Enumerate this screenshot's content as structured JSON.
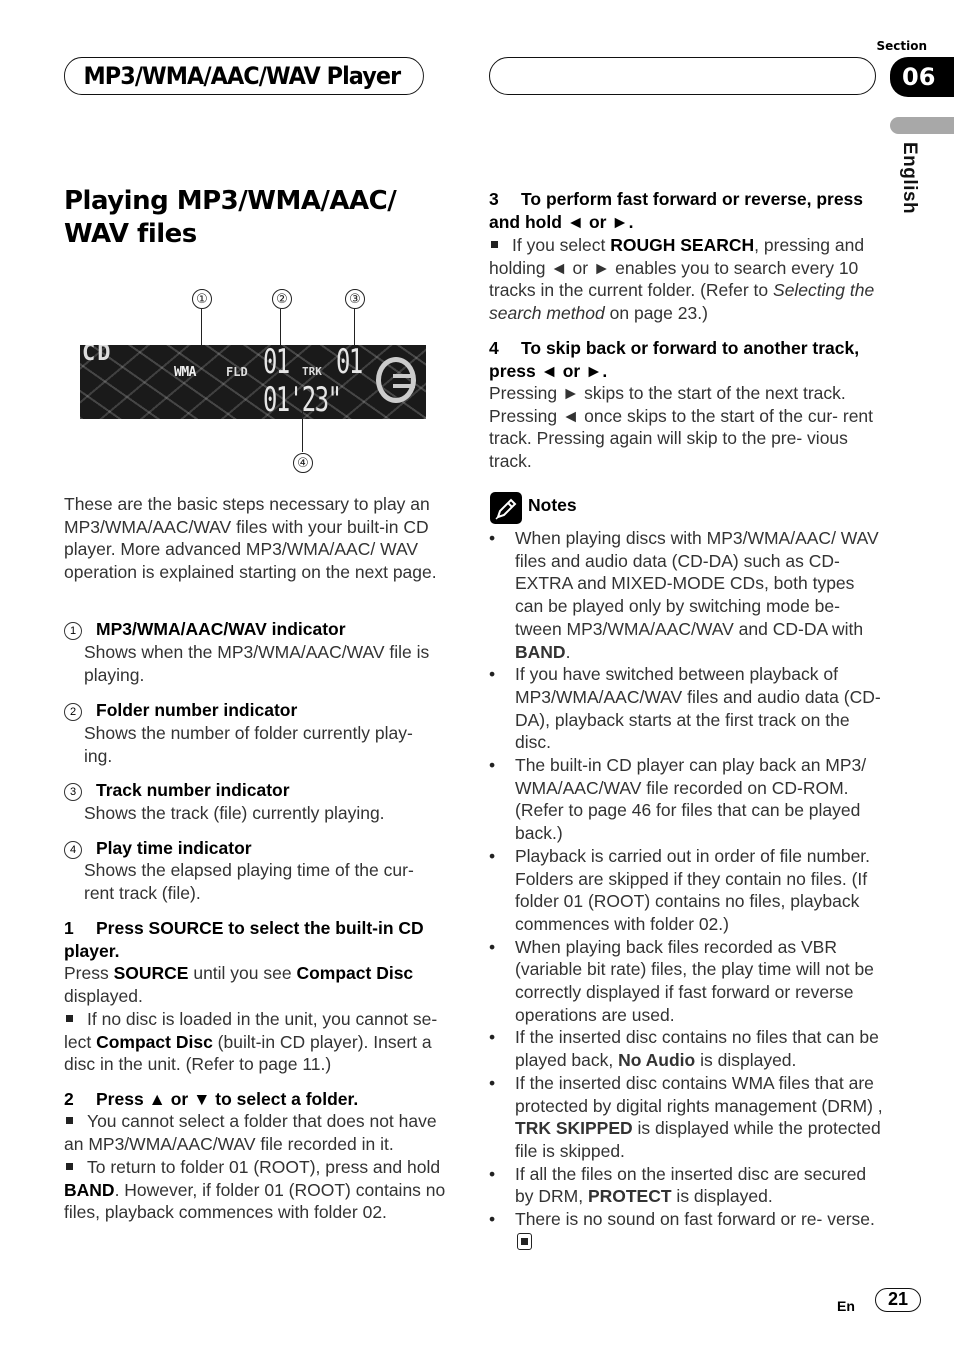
{
  "header": {
    "title": "MP3/WMA/AAC/WAV Player",
    "section_label": "Section",
    "section_number": "06",
    "language": "English"
  },
  "page_title": "Playing MP3/WMA/AAC/ WAV files",
  "figure": {
    "callouts": [
      "①",
      "②",
      "③",
      "④"
    ],
    "display": {
      "source": "CD",
      "format": "WMA",
      "folder_label": "FLD",
      "folder_number": "01",
      "track_label": "TRK",
      "track_number": "01",
      "play_time": "01'23\""
    }
  },
  "intro": "These are the basic steps necessary to play an MP3/WMA/AAC/WAV files with your built-in CD player. More advanced MP3/WMA/AAC/ WAV operation is explained starting on the next page.",
  "indicators": [
    {
      "marker": "1",
      "title": "MP3/WMA/AAC/WAV indicator",
      "desc": "Shows when the MP3/WMA/AAC/WAV file is playing."
    },
    {
      "marker": "2",
      "title": "Folder number indicator",
      "desc": "Shows the number of folder currently play- ing."
    },
    {
      "marker": "3",
      "title": "Track number indicator",
      "desc": "Shows the track (file) currently playing."
    },
    {
      "marker": "4",
      "title": "Play time indicator",
      "desc": "Shows the elapsed playing time of the cur- rent track (file)."
    }
  ],
  "steps": [
    {
      "number": "1",
      "heading": "Press SOURCE to select the built-in CD player.",
      "body_pre": "Press ",
      "body_b1": "SOURCE",
      "body_mid": " until you see ",
      "body_b2": "Compact Disc",
      "body_post": " displayed.",
      "note_pre": "If no disc is loaded in the unit, you cannot se- lect ",
      "note_b": "Compact Disc",
      "note_post": " (built-in CD player). Insert a disc in the unit. (Refer to page 11.)"
    },
    {
      "number": "2",
      "heading": "Press ▲ or ▼ to select a folder.",
      "note1": "You cannot select a folder that does not have an MP3/WMA/AAC/WAV file recorded in it.",
      "note2_pre": "To return to folder 01 (ROOT), press and hold ",
      "note2_b": "BAND",
      "note2_post": ". However, if folder 01 (ROOT) contains no files, playback commences with folder 02."
    },
    {
      "number": "3",
      "heading": "To perform fast forward or reverse, press and hold ◄ or ►.",
      "note_pre": "If you select ",
      "note_b": "ROUGH SEARCH",
      "note_mid": ", pressing and holding ◄ or ► enables you to search every 10 tracks in the current folder. (Refer to ",
      "note_i": "Selecting the search method",
      "note_post": " on page 23.)"
    },
    {
      "number": "4",
      "heading": "To skip back or forward to another track, press ◄ or ►.",
      "body": "Pressing ► skips to the start of the next track. Pressing ◄ once skips to the start of the cur- rent track. Pressing again will skip to the pre- vious track."
    }
  ],
  "notes": {
    "label": "Notes",
    "items": [
      {
        "pre": "When playing discs with MP3/WMA/AAC/ WAV files and audio data (CD-DA) such as CD-EXTRA and MIXED-MODE CDs, both types can be played only by switching mode be- tween MP3/WMA/AAC/WAV and CD-DA with ",
        "b": "BAND",
        "post": "."
      },
      {
        "pre": "If you have switched between playback of MP3/WMA/AAC/WAV files and audio data (CD-DA), playback starts at the first track on the disc.",
        "b": "",
        "post": ""
      },
      {
        "pre": "The built-in CD player can play back an MP3/ WMA/AAC/WAV file recorded on CD-ROM. (Refer to page 46 for files that can be played back.)",
        "b": "",
        "post": ""
      },
      {
        "pre": "Playback is carried out in order of file number. Folders are skipped if they contain no files. (If folder 01 (ROOT) contains no files, playback commences with folder 02.)",
        "b": "",
        "post": ""
      },
      {
        "pre": "When playing back files recorded as VBR (variable bit rate) files, the play time will not be correctly displayed if fast forward or reverse operations are used.",
        "b": "",
        "post": ""
      },
      {
        "pre": "If the inserted disc contains no files that can be played back, ",
        "b": "No Audio",
        "post": " is displayed."
      },
      {
        "pre": "If the inserted disc contains WMA files that are protected by digital rights management (DRM) , ",
        "b": "TRK SKIPPED",
        "post": " is displayed while the protected file is skipped."
      },
      {
        "pre": "If all the files on the inserted disc are secured by DRM, ",
        "b": "PROTECT",
        "post": " is displayed."
      },
      {
        "pre": "There is no sound on fast forward or re- verse.",
        "b": "",
        "post": ""
      }
    ]
  },
  "footer": {
    "lang_code": "En",
    "page_number": "21"
  }
}
